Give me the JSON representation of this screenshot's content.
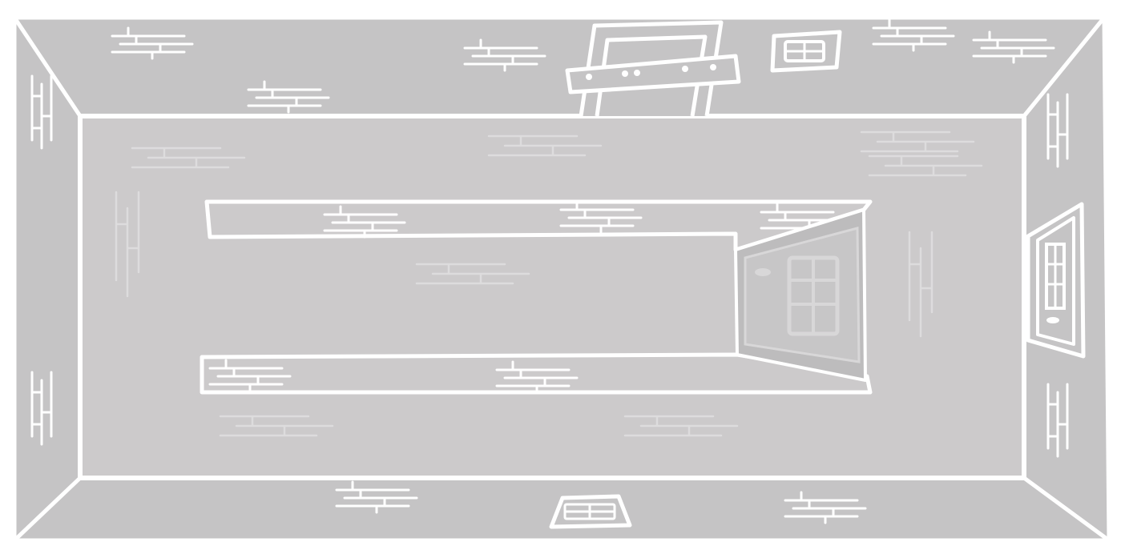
{
  "scene": {
    "title": "",
    "colors": {
      "background": "#ffffff",
      "wall": "#c5c4c5",
      "floor": "#cccacb",
      "line": "#ffffff",
      "faint_line": "#dddcdd",
      "door_shade": "#bdbcbd"
    },
    "objects": [
      {
        "name": "boarded-door",
        "icon": "boarded-door-icon",
        "wall": "top"
      },
      {
        "name": "wall-vent",
        "icon": "vent-icon",
        "wall": "top"
      },
      {
        "name": "side-door",
        "icon": "door-icon",
        "wall": "right"
      },
      {
        "name": "floor-vent",
        "icon": "vent-icon",
        "wall": "bottom"
      },
      {
        "name": "center-door",
        "icon": "door-icon",
        "wall": "floor"
      }
    ]
  }
}
